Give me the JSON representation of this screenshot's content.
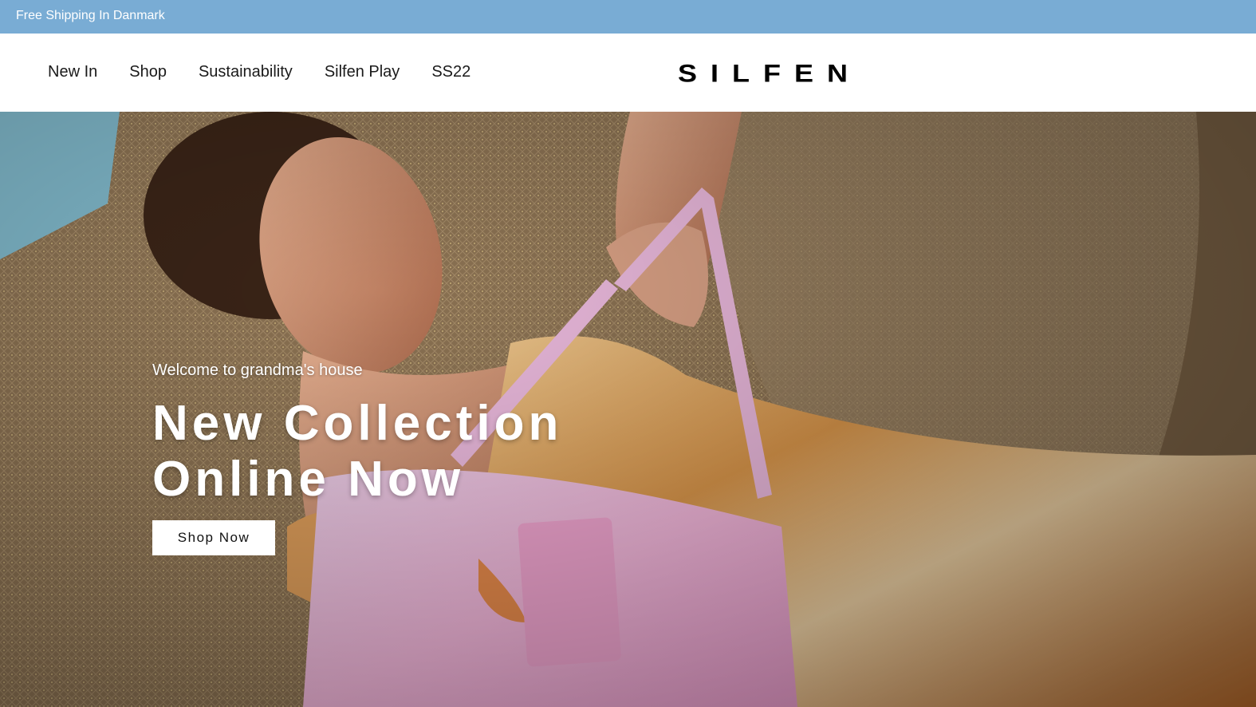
{
  "announcement": {
    "text": "Free Shipping In Danmark"
  },
  "nav": {
    "items": [
      {
        "label": "New In"
      },
      {
        "label": "Shop"
      },
      {
        "label": "Sustainability"
      },
      {
        "label": "Silfen Play"
      },
      {
        "label": "SS22"
      }
    ]
  },
  "brand": {
    "logo": "SILFEN"
  },
  "hero": {
    "subtitle": "Welcome to grandma's house",
    "title_line1": "New Collection",
    "title_line2": "Online Now",
    "cta_label": "Shop Now",
    "image_description_icon": "woman-with-pink-bag-photo"
  },
  "colors": {
    "announcement_bg": "#79acd4",
    "header_bg": "#ffffff",
    "hero_text": "#ffffff",
    "button_bg": "#ffffff"
  }
}
